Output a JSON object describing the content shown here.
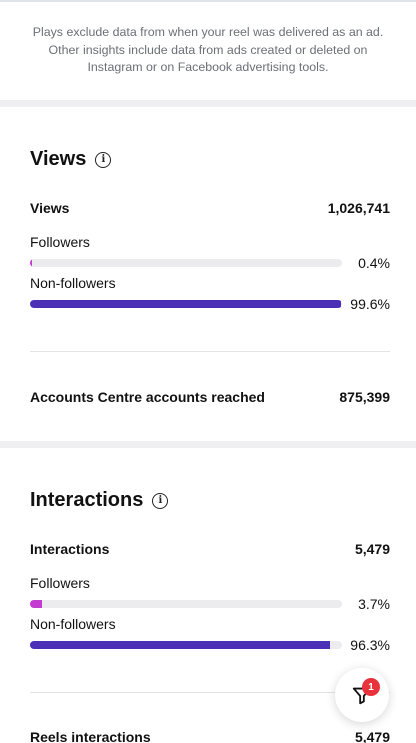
{
  "disclaimer": {
    "line1": "Plays exclude data from when your reel was delivered as an ad.",
    "line2": "Other insights include data from ads created or deleted on",
    "line3": "Instagram or on Facebook advertising tools."
  },
  "views_section": {
    "title": "Views",
    "info_icon": "info-icon",
    "total_label": "Views",
    "total_value": "1,026,741",
    "followers_label": "Followers",
    "followers_pct": "0.4%",
    "followers_fraction": 0.004,
    "nonfollowers_label": "Non-followers",
    "nonfollowers_pct": "99.6%",
    "nonfollowers_fraction": 0.996,
    "reached_label": "Accounts Centre accounts reached",
    "reached_value": "875,399"
  },
  "interactions_section": {
    "title": "Interactions",
    "info_icon": "info-icon",
    "total_label": "Interactions",
    "total_value": "5,479",
    "followers_label": "Followers",
    "followers_pct": "3.7%",
    "followers_fraction": 0.037,
    "nonfollowers_label": "Non-followers",
    "nonfollowers_pct": "96.3%",
    "nonfollowers_fraction": 0.963,
    "reels_label": "Reels interactions",
    "reels_value": "5,479"
  },
  "fab": {
    "icon": "filter-icon",
    "badge": "1"
  },
  "colors": {
    "followers_bar": "#c43bd1",
    "nonfollowers_bar": "#4b2fb7",
    "track": "#ececee",
    "badge": "#e8323c"
  }
}
